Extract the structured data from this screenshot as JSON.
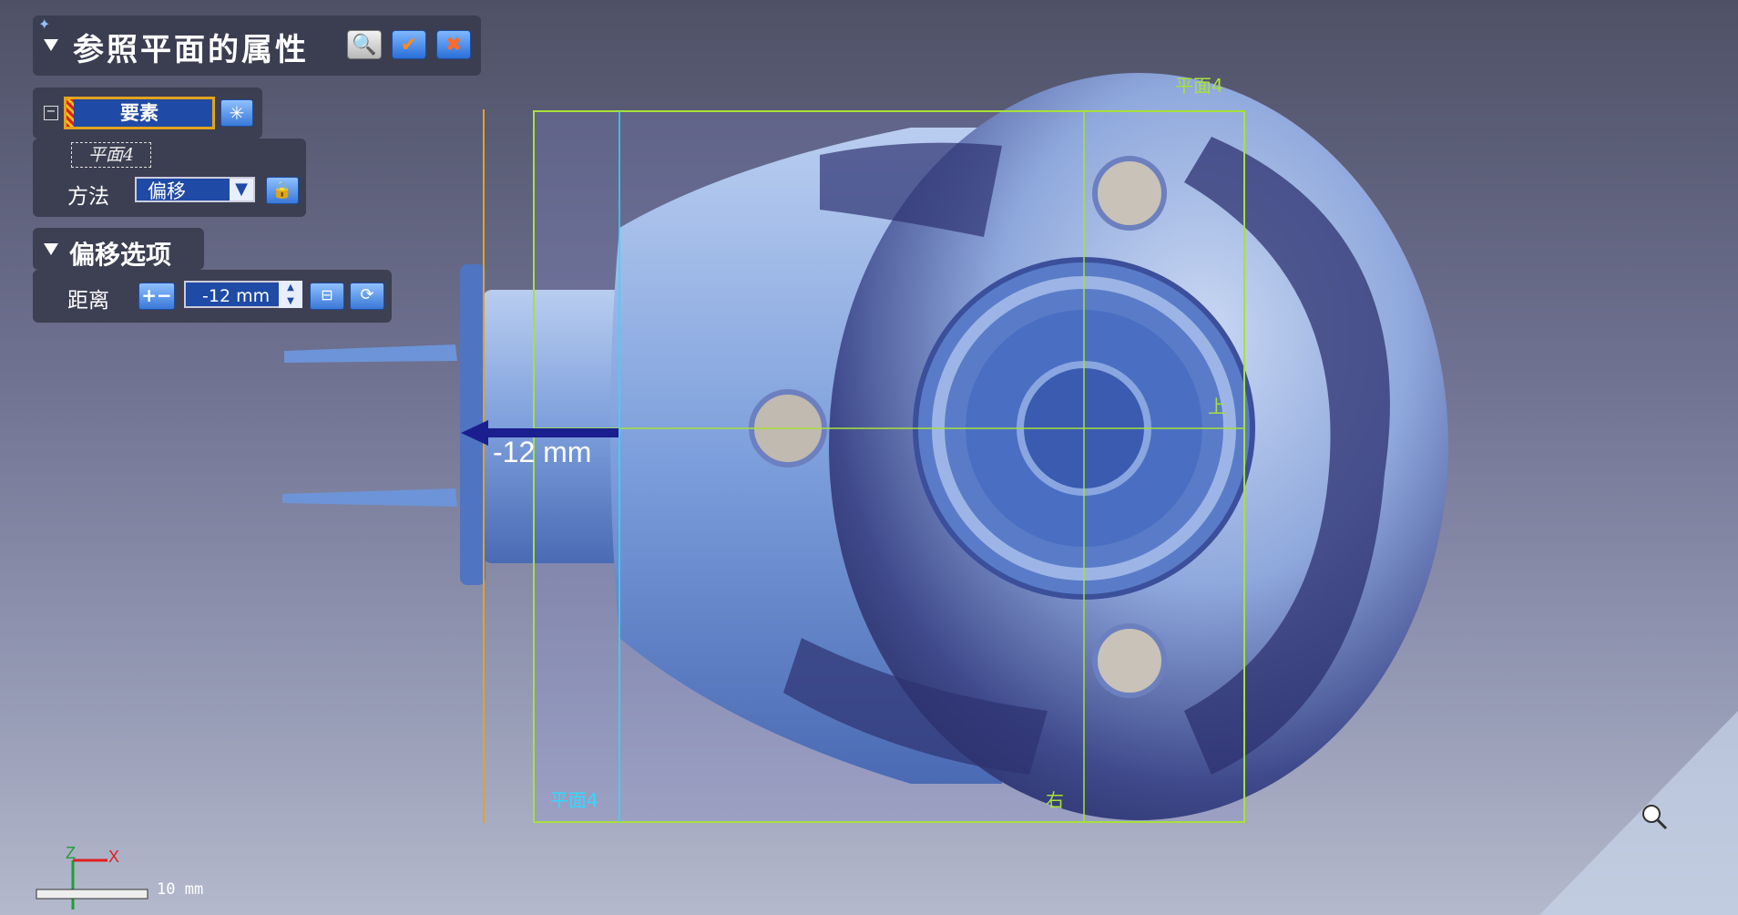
{
  "dialog": {
    "title": "参照平面的属性",
    "element": {
      "field_label": "要素",
      "plane_tag": "平面4",
      "method_label": "方法",
      "method_value": "偏移"
    },
    "offset_options": {
      "title": "偏移选项",
      "distance_label": "距离",
      "distance_value": "-12 mm",
      "pm_label": "+−"
    }
  },
  "viewport": {
    "dimension_label": "-12 mm",
    "plane_labels": {
      "top_right": "平面4",
      "bottom_left": "平面4",
      "right": "右",
      "top": "上"
    },
    "scale_bar": {
      "text": "10 mm"
    },
    "axes": {
      "x": "X",
      "z": "Z"
    },
    "colors": {
      "plane_frame": "#a8e03a",
      "cyan_label": "#34d8ff",
      "orange_line": "#e8a020",
      "arrow": "#1a1e8f"
    }
  }
}
